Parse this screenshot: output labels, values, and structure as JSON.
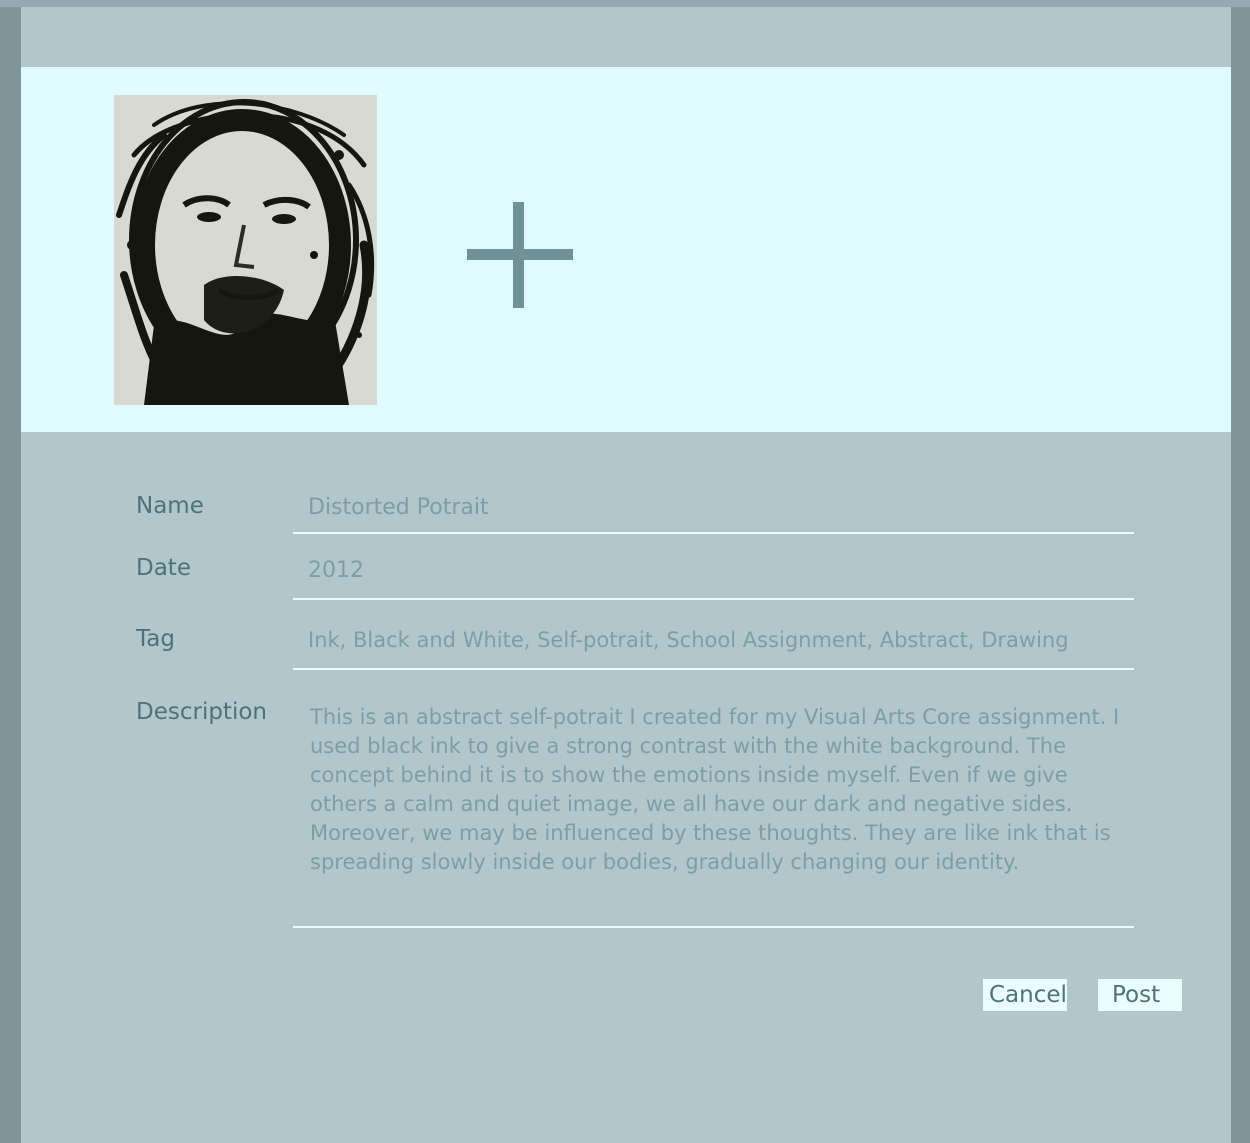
{
  "gallery": {
    "thumbnail_alt": "Ink self-portrait drawing",
    "add_icon": "plus-icon"
  },
  "form": {
    "name_label": "Name",
    "name_value": "Distorted Potrait",
    "date_label": "Date",
    "date_value": "2012",
    "tag_label": "Tag",
    "tag_value": "Ink, Black and White, Self-potrait, School Assignment, Abstract, Drawing",
    "description_label": "Description",
    "description_value": "This is an abstract self-potrait I created for my Visual Arts Core assignment. I used black ink to give a strong contrast with the white background. The concept behind it is to show the emotions inside myself. Even if we give others a calm and quiet image, we all have our dark and negative sides. Moreover, we may be influenced by these thoughts. They are like ink that is spreading slowly inside our bodies, gradually changing our identity."
  },
  "actions": {
    "cancel_label": "Cancel",
    "post_label": "Post"
  },
  "colors": {
    "background": "#7f9599",
    "panel": "#b1c7cc",
    "gallery": "#e0fbff",
    "accent": "#6f9198",
    "label_text": "#4f7279",
    "value_text": "#7d9ea4",
    "button_bg": "#eafdff"
  }
}
